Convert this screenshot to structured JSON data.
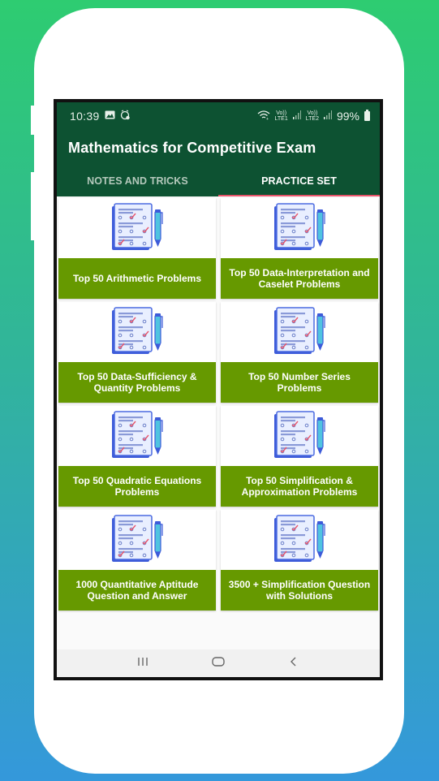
{
  "status_bar": {
    "time": "10:39",
    "left_icons": [
      "gallery-icon",
      "alarm-icon"
    ],
    "right_icons": [
      "wifi-icon",
      "volte-lte1-signal-icon",
      "volte-lte2-signal-icon"
    ],
    "lte1_label": "LTE1",
    "lte2_label": "LTE2",
    "volte_label": "Vo))",
    "battery": "99%"
  },
  "app_bar": {
    "title": "Mathematics for Competitive Exam"
  },
  "tabs": [
    {
      "label": "NOTES AND TRICKS",
      "active": false
    },
    {
      "label": "PRACTICE SET",
      "active": true
    }
  ],
  "cards": [
    {
      "title": "Top 50 Arithmetic Problems",
      "icon": "checklist-pen-icon"
    },
    {
      "title": "Top 50 Data-Interpretation and Caselet Problems",
      "icon": "checklist-pen-icon"
    },
    {
      "title": "Top 50 Data-Sufficiency & Quantity Problems",
      "icon": "checklist-pen-icon"
    },
    {
      "title": "Top 50 Number Series Problems",
      "icon": "checklist-pen-icon"
    },
    {
      "title": "Top 50 Quadratic Equations Problems",
      "icon": "checklist-pen-icon"
    },
    {
      "title": "Top 50 Simplification & Approximation Problems",
      "icon": "checklist-pen-icon"
    },
    {
      "title": "1000 Quantitative Aptitude Question and Answer",
      "icon": "checklist-pen-icon"
    },
    {
      "title": "3500 + Simplification Question with Solutions",
      "icon": "checklist-pen-icon"
    }
  ],
  "nav_bar": {
    "recents": "recents",
    "home": "home",
    "back": "back"
  },
  "colors": {
    "primary_dark": "#0d5232",
    "card_label_bg": "#669900",
    "tab_indicator": "#e8546a",
    "page_gradient_top": "#2ecc71",
    "page_gradient_bottom": "#3498db"
  }
}
